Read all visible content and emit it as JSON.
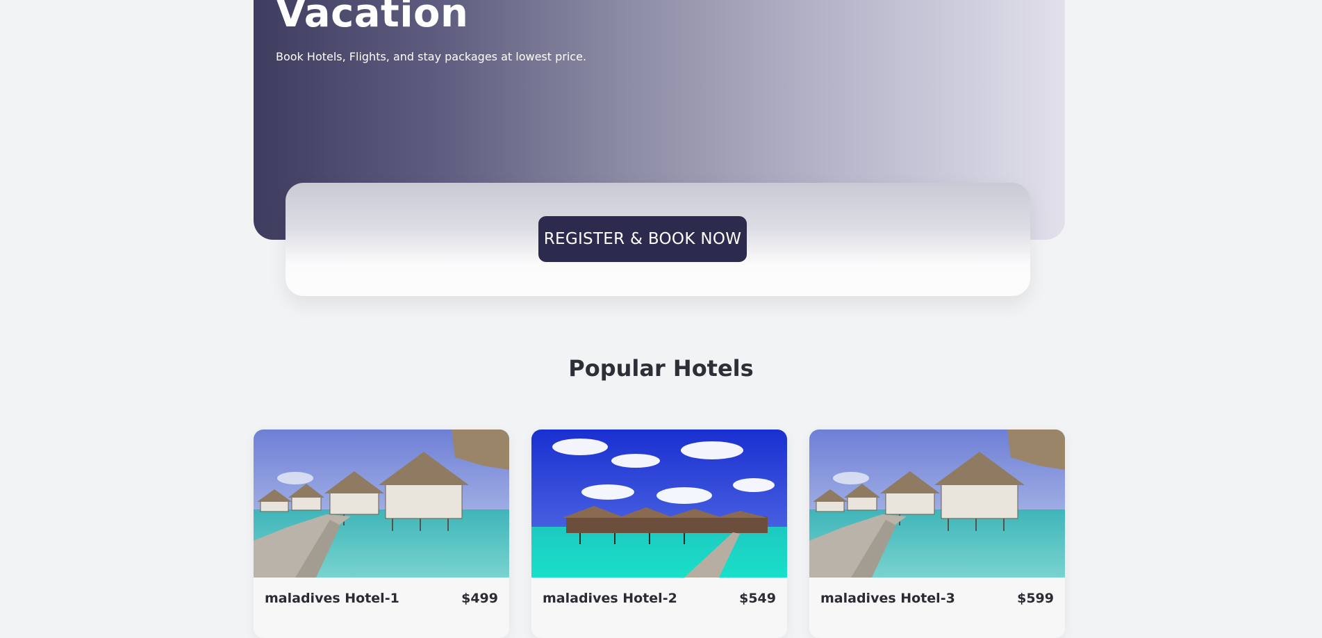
{
  "hero": {
    "title": "Vacation",
    "subtitle": "Book Hotels, Flights, and stay packages at lowest price."
  },
  "cta": {
    "button_label": "REGISTER & BOOK NOW"
  },
  "popular": {
    "title": "Popular Hotels",
    "hotels": [
      {
        "name": "maladives Hotel-1",
        "price": "$499",
        "image": "overwater-bungalows-boardwalk-photo"
      },
      {
        "name": "maladives Hotel-2",
        "price": "$549",
        "image": "overwater-villas-blue-sky-photo"
      },
      {
        "name": "maladives Hotel-3",
        "price": "$599",
        "image": "overwater-bungalows-boardwalk-photo"
      }
    ]
  },
  "colors": {
    "page_bg": "#f2f3f5",
    "hero_gradient_start": "#3f3d5f",
    "hero_gradient_end": "#e1e0eb",
    "button_bg": "#2c2a4d",
    "text_dark": "#2b2b33"
  }
}
